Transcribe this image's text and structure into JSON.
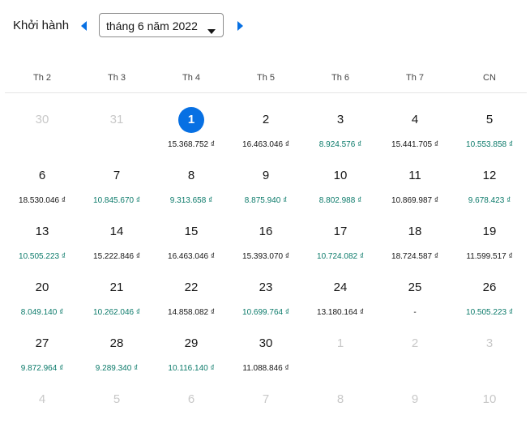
{
  "header": {
    "depart_label": "Khởi hành",
    "month_value": "tháng 6 năm 2022",
    "accent_color": "#0770e3"
  },
  "weekdays": [
    "Th 2",
    "Th 3",
    "Th 4",
    "Th 5",
    "Th 6",
    "Th 7",
    "CN"
  ],
  "calendar": {
    "selected_day": "1",
    "rows": [
      [
        {
          "day": "30",
          "price": "",
          "state": "other"
        },
        {
          "day": "31",
          "price": "",
          "state": "other"
        },
        {
          "day": "1",
          "price": "15.368.752 ₫",
          "state": "selected"
        },
        {
          "day": "2",
          "price": "16.463.046 ₫",
          "state": "normal"
        },
        {
          "day": "3",
          "price": "8.924.576 ₫",
          "state": "cheap"
        },
        {
          "day": "4",
          "price": "15.441.705 ₫",
          "state": "normal"
        },
        {
          "day": "5",
          "price": "10.553.858 ₫",
          "state": "cheap"
        }
      ],
      [
        {
          "day": "6",
          "price": "18.530.046 ₫",
          "state": "normal"
        },
        {
          "day": "7",
          "price": "10.845.670 ₫",
          "state": "cheap"
        },
        {
          "day": "8",
          "price": "9.313.658 ₫",
          "state": "cheap"
        },
        {
          "day": "9",
          "price": "8.875.940 ₫",
          "state": "cheap"
        },
        {
          "day": "10",
          "price": "8.802.988 ₫",
          "state": "cheap"
        },
        {
          "day": "11",
          "price": "10.869.987 ₫",
          "state": "normal"
        },
        {
          "day": "12",
          "price": "9.678.423 ₫",
          "state": "cheap"
        }
      ],
      [
        {
          "day": "13",
          "price": "10.505.223 ₫",
          "state": "cheap"
        },
        {
          "day": "14",
          "price": "15.222.846 ₫",
          "state": "normal"
        },
        {
          "day": "15",
          "price": "16.463.046 ₫",
          "state": "normal"
        },
        {
          "day": "16",
          "price": "15.393.070 ₫",
          "state": "normal"
        },
        {
          "day": "17",
          "price": "10.724.082 ₫",
          "state": "cheap"
        },
        {
          "day": "18",
          "price": "18.724.587 ₫",
          "state": "normal"
        },
        {
          "day": "19",
          "price": "11.599.517 ₫",
          "state": "normal"
        }
      ],
      [
        {
          "day": "20",
          "price": "8.049.140 ₫",
          "state": "cheap"
        },
        {
          "day": "21",
          "price": "10.262.046 ₫",
          "state": "cheap"
        },
        {
          "day": "22",
          "price": "14.858.082 ₫",
          "state": "normal"
        },
        {
          "day": "23",
          "price": "10.699.764 ₫",
          "state": "cheap"
        },
        {
          "day": "24",
          "price": "13.180.164 ₫",
          "state": "normal"
        },
        {
          "day": "25",
          "price": "-",
          "state": "normal"
        },
        {
          "day": "26",
          "price": "10.505.223 ₫",
          "state": "cheap"
        }
      ],
      [
        {
          "day": "27",
          "price": "9.872.964 ₫",
          "state": "cheap"
        },
        {
          "day": "28",
          "price": "9.289.340 ₫",
          "state": "cheap"
        },
        {
          "day": "29",
          "price": "10.116.140 ₫",
          "state": "cheap"
        },
        {
          "day": "30",
          "price": "11.088.846 ₫",
          "state": "normal"
        },
        {
          "day": "1",
          "price": "",
          "state": "other"
        },
        {
          "day": "2",
          "price": "",
          "state": "other"
        },
        {
          "day": "3",
          "price": "",
          "state": "other"
        }
      ],
      [
        {
          "day": "4",
          "price": "",
          "state": "other"
        },
        {
          "day": "5",
          "price": "",
          "state": "other"
        },
        {
          "day": "6",
          "price": "",
          "state": "other"
        },
        {
          "day": "7",
          "price": "",
          "state": "other"
        },
        {
          "day": "8",
          "price": "",
          "state": "other"
        },
        {
          "day": "9",
          "price": "",
          "state": "other"
        },
        {
          "day": "10",
          "price": "",
          "state": "other"
        }
      ]
    ]
  },
  "icons": {
    "prev": "triangle-left-icon",
    "next": "triangle-right-icon",
    "dropdown": "chevron-down-icon"
  }
}
